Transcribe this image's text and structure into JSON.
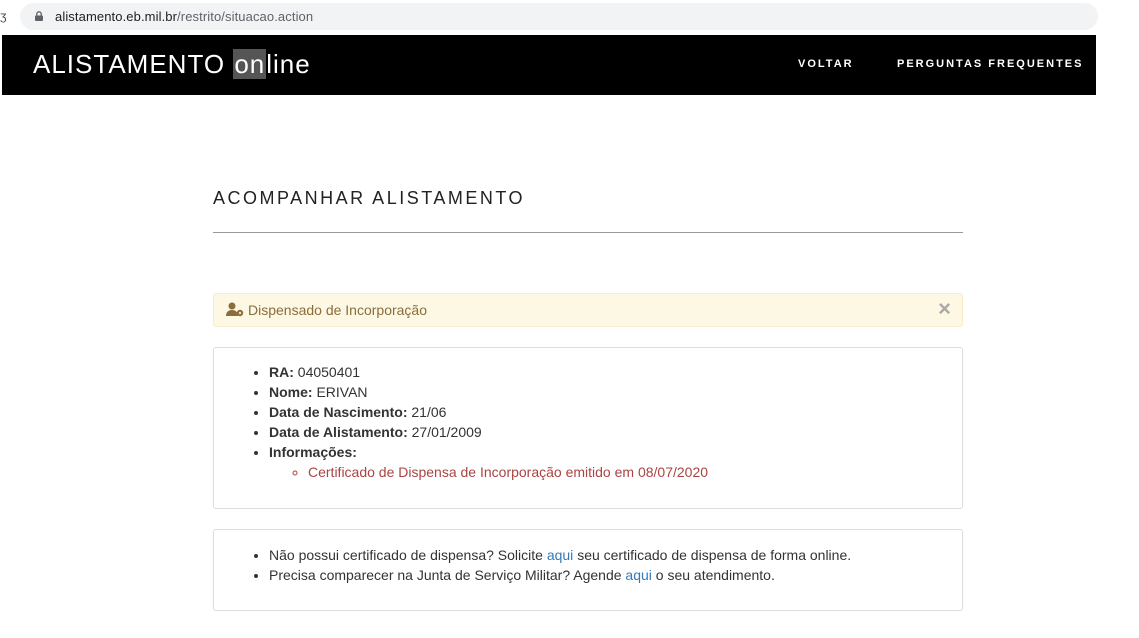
{
  "browser": {
    "url_host": "alistamento.eb.mil.br",
    "url_path": "/restrito/situacao.action",
    "edge_glyph": "ʒ"
  },
  "navbar": {
    "brand_prefix": "ALISTAMENTO",
    "brand_highlight": "on",
    "brand_suffix": "line",
    "links": [
      "VOLTAR",
      "PERGUNTAS FREQUENTES"
    ]
  },
  "page": {
    "title": "ACOMPANHAR ALISTAMENTO"
  },
  "alert": {
    "icon": "user-icon",
    "text": "Dispensado de Incorporação",
    "close": "×",
    "colors": {
      "background": "#fcf8e3",
      "text": "#8a6d3b"
    }
  },
  "details": {
    "ra_label": "RA:",
    "ra_value": "04050401",
    "name_label": "Nome:",
    "name_value": "ERIVAN",
    "birth_label": "Data de Nascimento:",
    "birth_value": "21/06",
    "enlist_label": "Data de Alistamento:",
    "enlist_value": "27/01/2009",
    "info_label": "Informações:",
    "info_items": [
      "Certificado de Dispensa de Incorporação emitido em 08/07/2020"
    ]
  },
  "help": {
    "line1_before": "Não possui certificado de dispensa? Solicite",
    "line1_link": "aqui",
    "line1_after": "seu certificado de dispensa de forma online.",
    "line2_before": "Precisa comparecer na Junta de Serviço Militar? Agende",
    "line2_link": "aqui",
    "line2_after": "o seu atendimento."
  }
}
